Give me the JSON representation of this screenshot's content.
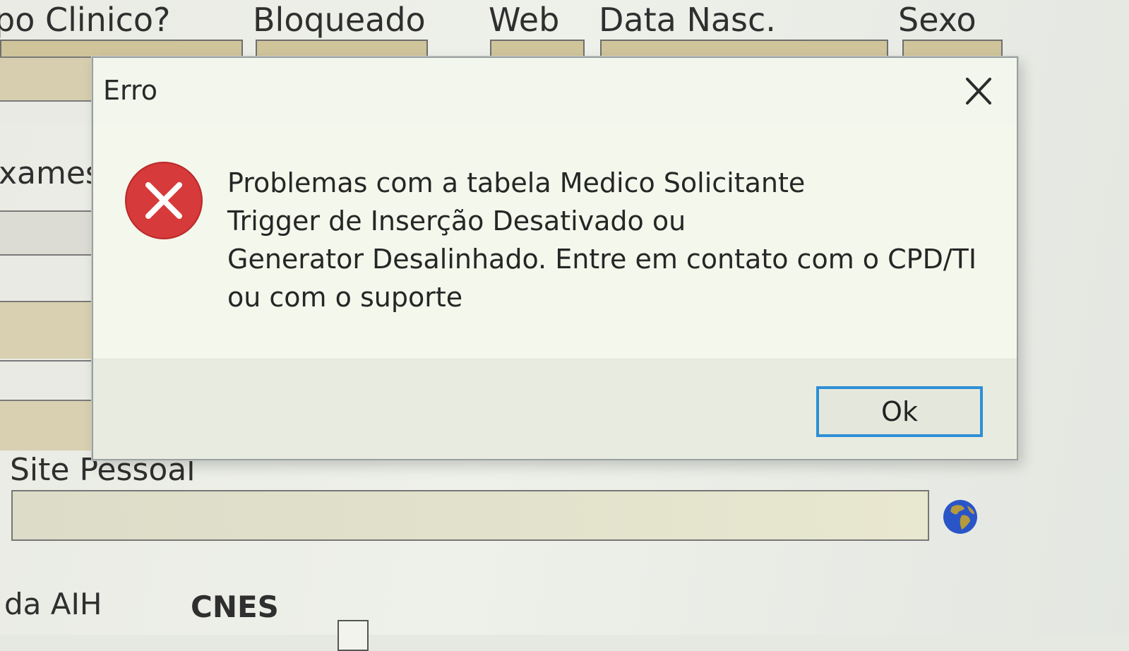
{
  "background_form": {
    "columns": {
      "clinico": "po Clinico?",
      "bloqueado": "Bloqueado",
      "web": "Web",
      "data_nasc": "Data Nasc.",
      "sexo": "Sexo"
    },
    "exames_label": "xames",
    "site_pessoal": {
      "label": "Site Pessoal",
      "value": ""
    },
    "aih_label": "da AIH",
    "cnes_label": "CNES"
  },
  "dialog": {
    "title": "Erro",
    "message_lines": [
      "Problemas com a tabela Medico Solicitante",
      "Trigger de Inserção Desativado ou",
      "Generator Desalinhado. Entre em contato com o CPD/TI",
      "ou com o suporte"
    ],
    "ok_label": "Ok",
    "icon": "error-x-icon",
    "close_icon": "close-icon"
  },
  "colors": {
    "error_red": "#d63a3a",
    "focus_blue": "#2f8fd6",
    "field_tan": "#cfc49a"
  }
}
